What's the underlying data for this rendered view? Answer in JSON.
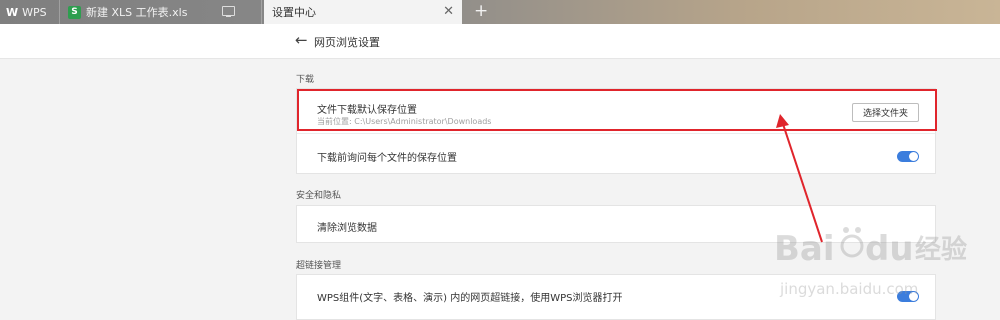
{
  "tabs": [
    {
      "label": "WPS",
      "logo": "W"
    },
    {
      "label": "新建 XLS 工作表.xls",
      "icon_text": "S"
    },
    {
      "label": "设置中心",
      "close": "✕"
    }
  ],
  "add_tab": "+",
  "header": {
    "back": "←",
    "title": "网页浏览设置"
  },
  "sections": {
    "download": {
      "label": "下载",
      "rows": {
        "location": {
          "label": "文件下载默认保存位置",
          "current_path": "当前位置: C:\\Users\\Administrator\\Downloads",
          "button": "选择文件夹"
        },
        "ask": {
          "label": "下载前询问每个文件的保存位置",
          "toggle_on": true
        }
      }
    },
    "security": {
      "label": "安全和隐私",
      "rows": {
        "clear": {
          "label": "清除浏览数据"
        }
      }
    },
    "hyperlink": {
      "label": "超链接管理",
      "rows": {
        "open": {
          "label": "WPS组件(文字、表格、演示) 内的网页超链接，使用WPS浏览器打开",
          "toggle_on": true
        }
      }
    }
  },
  "watermark": {
    "brand": "Baidu",
    "cn": "经验",
    "url": "jingyan.baidu.com"
  },
  "colors": {
    "accent_blue": "#3b7ddd",
    "highlight_red": "#e0252c"
  }
}
